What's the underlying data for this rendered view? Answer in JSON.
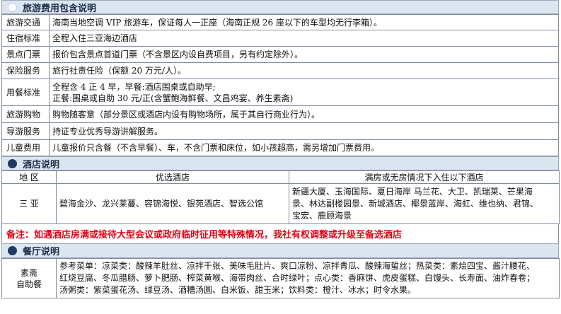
{
  "section1": {
    "title": "旅游费用包含说明",
    "rows": [
      {
        "label": "旅游交通",
        "text": "海南当地空调 VIP 旅游车，保证每人一正座（海南正规 26 座以下的车型均无行李箱）。"
      },
      {
        "label": "住宿标准",
        "text": "全程入住三亚海边酒店"
      },
      {
        "label": "景点门票",
        "text": "报价包含景点首道门票（不含景区内设自费项目，另有约定除外）。"
      },
      {
        "label": "保险服务",
        "text": "旅行社责任险（保额 20 万元/人）。"
      },
      {
        "label": "用餐标准",
        "lines": [
          "全程含 4 正 4 早，早餐:酒店围桌或自助早;",
          "正餐:围桌或自助 30 元/正(含蟹鲍海鲜餐、文昌鸡宴、养生素斋)"
        ]
      },
      {
        "label": "旅游购物",
        "text": "购物随客意（部分景区或酒店内设有购物场所，属于其自行商业行为）。"
      },
      {
        "label": "导游服务",
        "text": "持证专业优秀导游讲解服务。"
      },
      {
        "label": "儿童费用",
        "text": "儿童报价只含餐（不含早餐）、车，不含门票和床位，如小孩超高，需另增加门票费用。"
      }
    ]
  },
  "section2": {
    "title": "酒店说明",
    "headers": [
      "地 区",
      "优选酒店",
      "满房或无房情况下入住以下酒店"
    ],
    "region": "三 亚",
    "preferred": "碧海金沙、龙兴莱蔓、容锦海悦、银苑酒店、智选公馆",
    "alternative_lines": [
      "新疆大厦、玉海国际、夏日海岸 马兰花、大卫、凯瑞莱、芒果海",
      "景、林达副楼园景、新城酒店、椰景蓝岸、海虹、维也纳、君锦、",
      "宝宏、鹿顾海景"
    ]
  },
  "note": "备注：如遇酒店房满或接待大型会议或政府临时征用等特殊情况，我社有权调整或升级至备选酒店",
  "section3": {
    "title": "餐厅说明",
    "label_lines": [
      "素斋",
      "自助餐"
    ],
    "text_lines": [
      "参考菜单：凉菜类：酸辣羊肚丝、凉拌千张、美味毛肚片、爽口凉粉、凉拌青瓜、酸辣海蜇丝；热菜类：素烩四宝、酱汁腰花、",
      "红烧豆腐、冬瓜腊肠、萝卜肥肠、榨菜黄喉、海带肉丝、合时绿叶；点心类：香麻饼、虎皮蛋糕、白馒头、长寿面、油炸春卷；",
      "汤粥类：紫菜蛋花汤、绿豆汤、酒糟汤圆、白米饭、甜玉米；饮料类：橙汁、冰水；时令水果。"
    ]
  }
}
